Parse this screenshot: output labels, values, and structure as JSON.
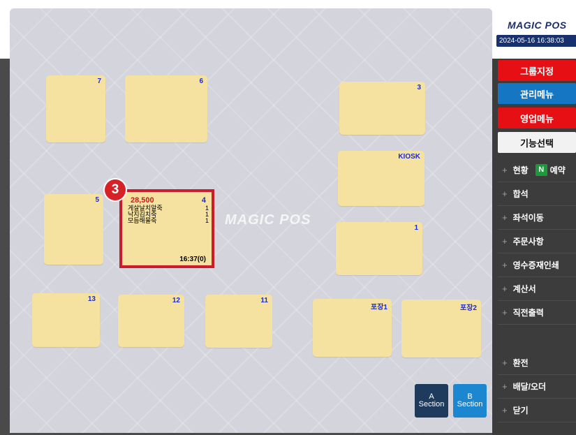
{
  "brand": "MAGIC POS",
  "datetime": "2024-05-16 16:38:03",
  "watermark": "MAGIC POS",
  "tables": {
    "t7": "7",
    "t6": "6",
    "t3": "3",
    "kiosk": "KIOSK",
    "t5": "5",
    "t1": "1",
    "t13": "13",
    "t12": "12",
    "t11": "11",
    "pack1": "포장1",
    "pack2": "포장2"
  },
  "active_table": {
    "badge": "3",
    "price": "28,500",
    "number": "4",
    "items": [
      {
        "name": "게살날치알죽",
        "qty": "1"
      },
      {
        "name": "낙지김치죽",
        "qty": "1"
      },
      {
        "name": "모듬해물죽",
        "qty": "1"
      }
    ],
    "time": "16:37(0)"
  },
  "sections": {
    "a_line1": "A",
    "a_line2": "Section",
    "b_line1": "B",
    "b_line2": "Section"
  },
  "buttons": {
    "group": "그룹지정",
    "manage": "관리메뉴",
    "sales": "영업메뉴",
    "func": "기능선택"
  },
  "menu": {
    "status": "현황",
    "naver_icon": "N",
    "reserve": "예약",
    "merge": "합석",
    "move": "좌석이동",
    "order_note": "주문사항",
    "receipt": "영수증재인쇄",
    "bill": "계산서",
    "direct_print": "직전출력",
    "exchange": "환전",
    "delivery": "배달/오더",
    "close": "닫기"
  },
  "colors": {
    "table_fill": "#f6e2a0",
    "table_number": "#1a2bd6",
    "active_border": "#cc1b2a",
    "red_button": "#e60f14",
    "blue_button": "#1576c4",
    "section_a": "#1e3a5c",
    "section_b": "#1d86d0"
  }
}
